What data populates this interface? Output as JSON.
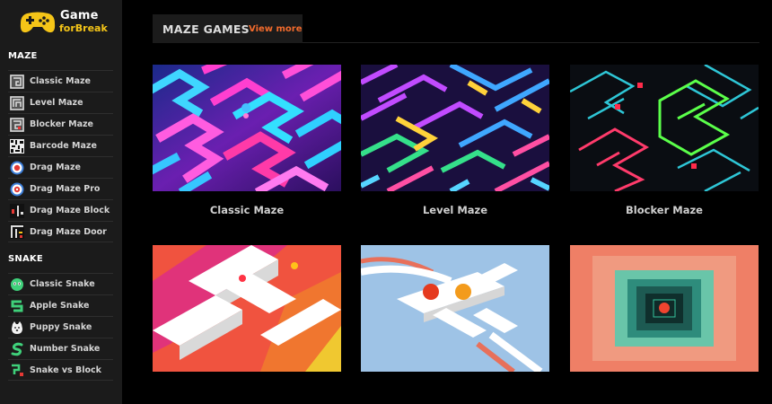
{
  "logo": {
    "line1": "Game",
    "line2": "forBreak"
  },
  "sidebar": {
    "maze": {
      "title": "MAZE",
      "items": [
        {
          "label": "Classic Maze",
          "icon": "classic-maze-icon"
        },
        {
          "label": "Level Maze",
          "icon": "level-maze-icon"
        },
        {
          "label": "Blocker Maze",
          "icon": "blocker-maze-icon"
        },
        {
          "label": "Barcode Maze",
          "icon": "barcode-maze-icon"
        },
        {
          "label": "Drag Maze",
          "icon": "drag-maze-icon"
        },
        {
          "label": "Drag Maze Pro",
          "icon": "drag-maze-pro-icon"
        },
        {
          "label": "Drag Maze Block",
          "icon": "drag-maze-block-icon"
        },
        {
          "label": "Drag Maze Door",
          "icon": "drag-maze-door-icon"
        }
      ]
    },
    "snake": {
      "title": "SNAKE",
      "items": [
        {
          "label": "Classic Snake",
          "icon": "classic-snake-icon"
        },
        {
          "label": "Apple Snake",
          "icon": "apple-snake-icon"
        },
        {
          "label": "Puppy Snake",
          "icon": "puppy-snake-icon"
        },
        {
          "label": "Number Snake",
          "icon": "number-snake-icon"
        },
        {
          "label": "Snake vs Block",
          "icon": "snake-vs-block-icon"
        }
      ]
    }
  },
  "main": {
    "section_title": "MAZE GAMES",
    "view_more": "View more",
    "cards": [
      {
        "title": "Classic Maze"
      },
      {
        "title": "Level Maze"
      },
      {
        "title": "Blocker Maze"
      },
      {
        "title": ""
      },
      {
        "title": ""
      },
      {
        "title": ""
      }
    ]
  },
  "colors": {
    "accent": "#f16a2c",
    "logo_yellow": "#f5c518",
    "sidebar_bg": "#1b1b1b",
    "page_bg": "#000000"
  }
}
